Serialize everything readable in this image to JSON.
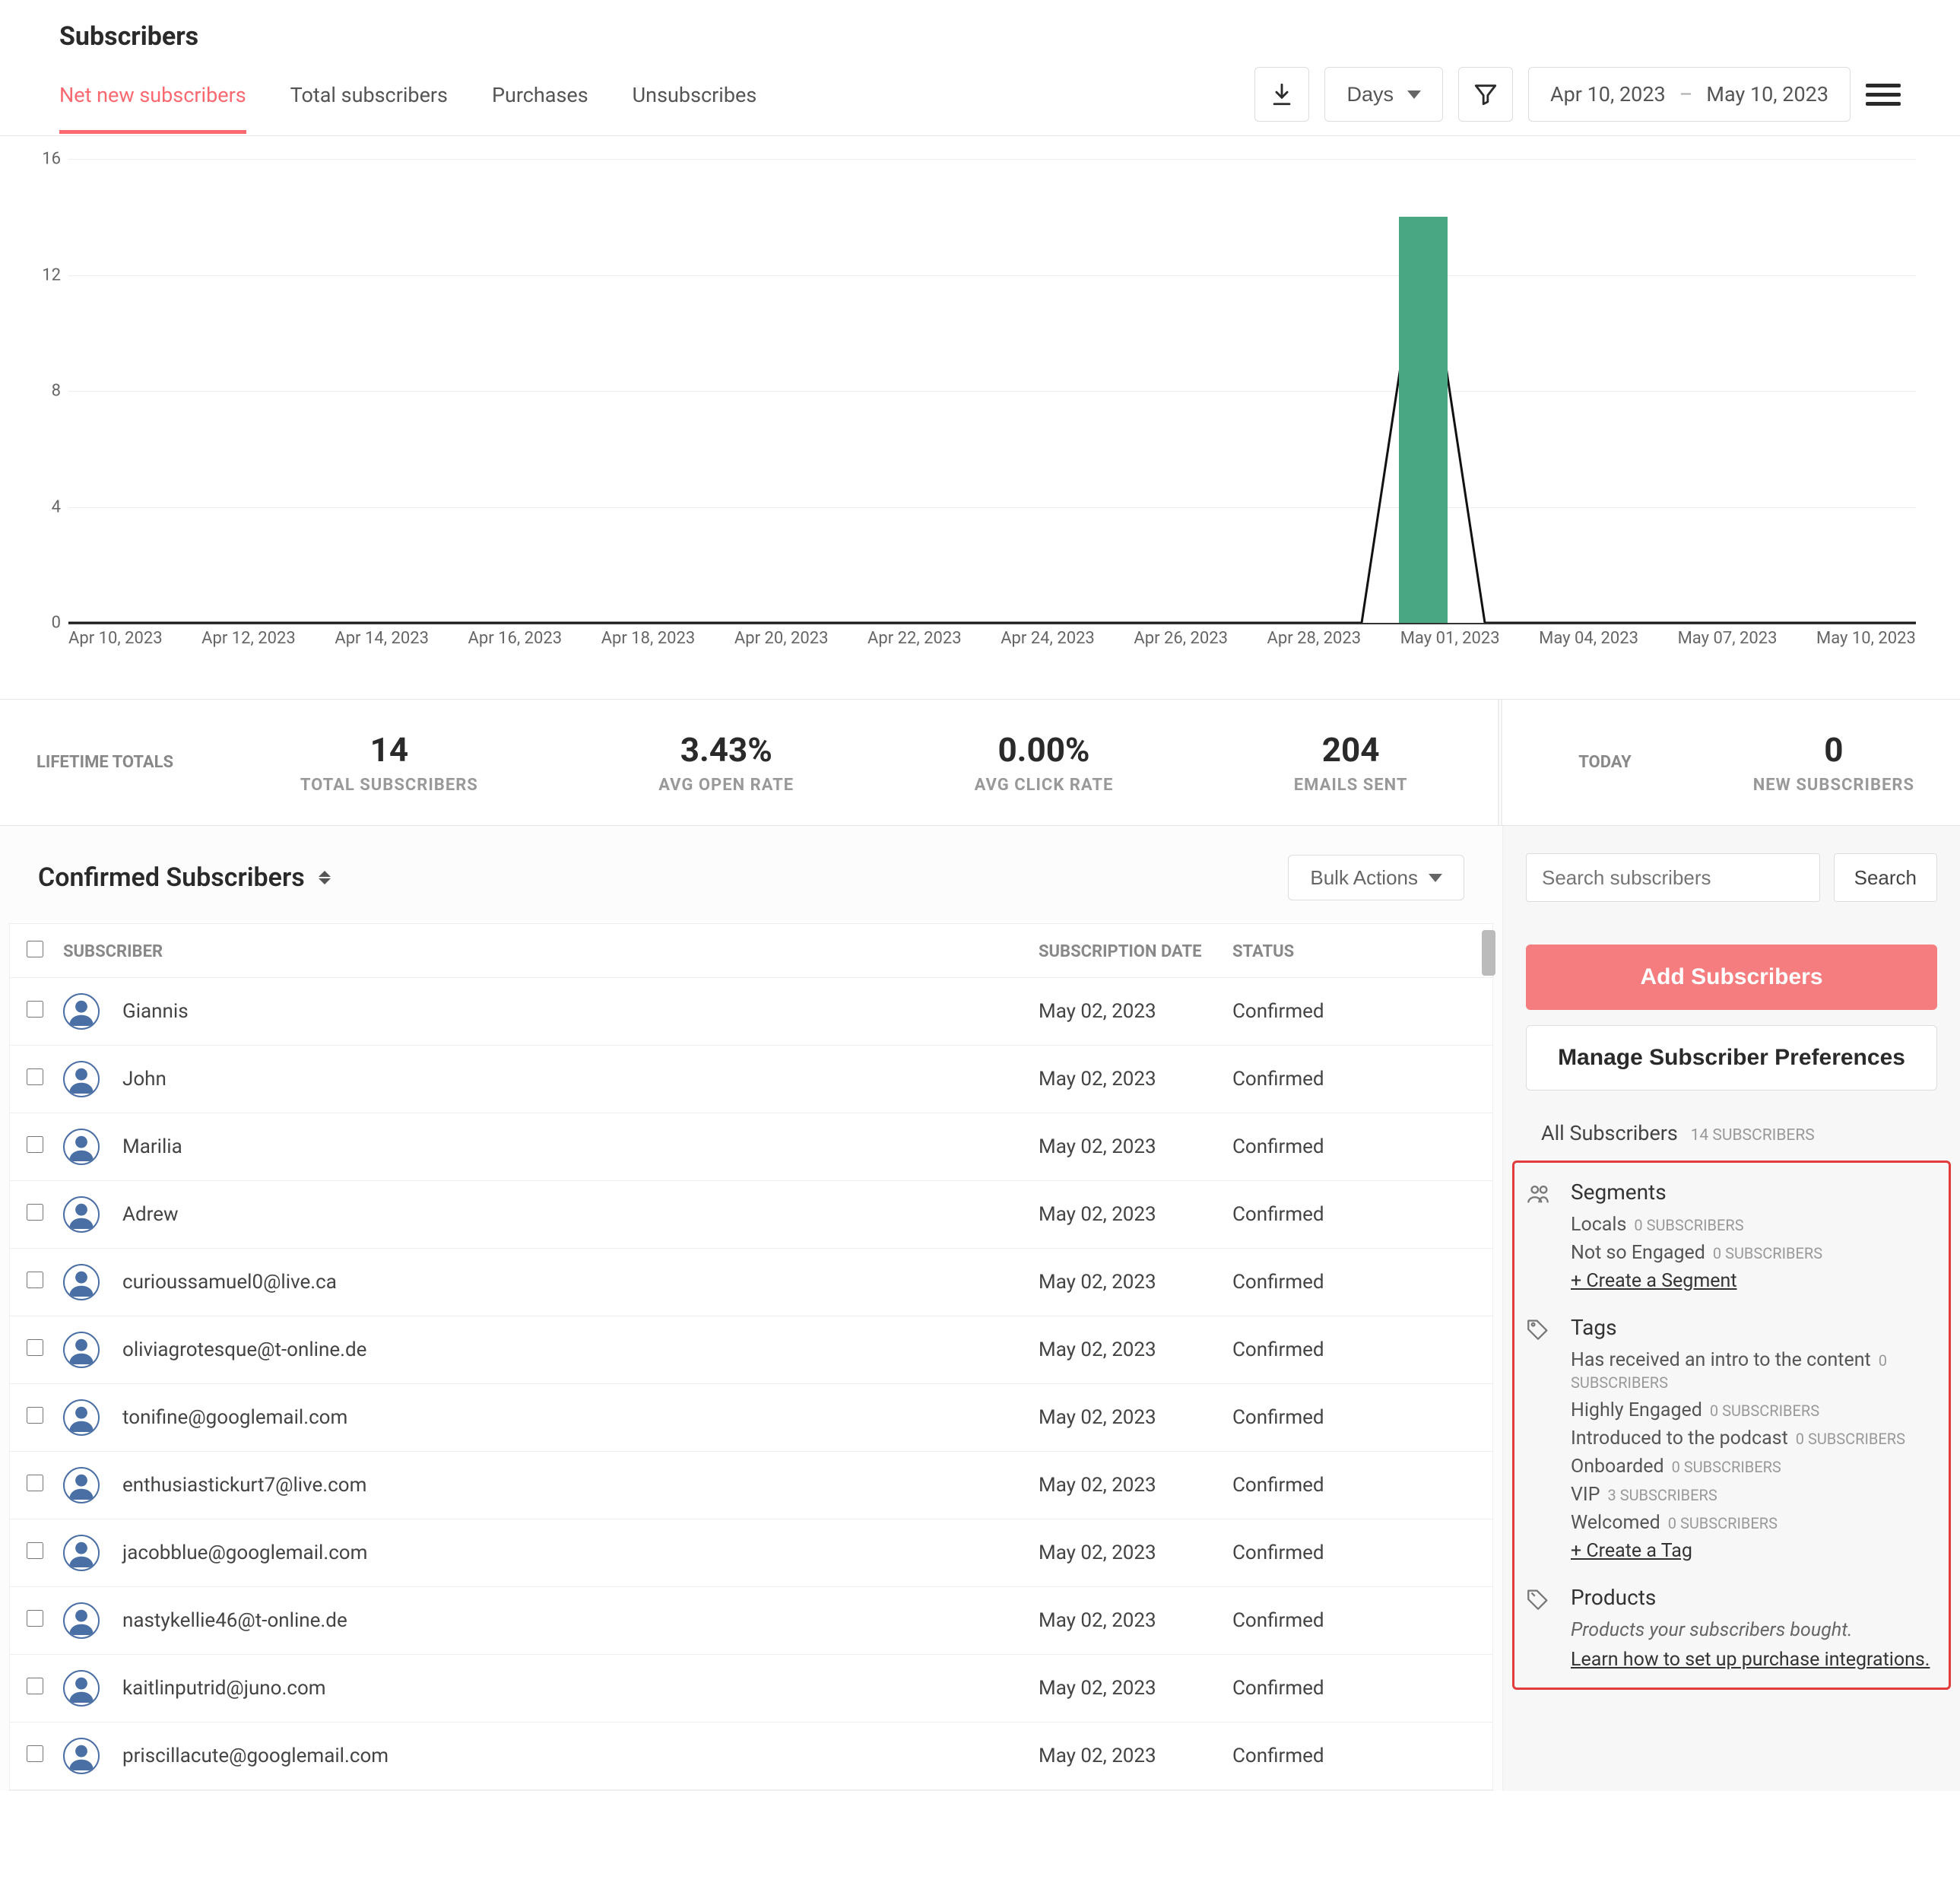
{
  "page": {
    "title": "Subscribers"
  },
  "tabs": {
    "items": [
      "Net new subscribers",
      "Total subscribers",
      "Purchases",
      "Unsubscribes"
    ],
    "active": 0
  },
  "controls": {
    "interval": "Days",
    "date_from": "Apr 10, 2023",
    "date_sep": "–",
    "date_to": "May 10, 2023"
  },
  "chart_data": {
    "type": "bar",
    "title": "",
    "xlabel": "",
    "ylabel": "",
    "ylim": [
      0,
      16
    ],
    "y_ticks": [
      0,
      4,
      8,
      12,
      16
    ],
    "x_labels": [
      "Apr 10, 2023",
      "Apr 12, 2023",
      "Apr 14, 2023",
      "Apr 16, 2023",
      "Apr 18, 2023",
      "Apr 20, 2023",
      "Apr 22, 2023",
      "Apr 24, 2023",
      "Apr 26, 2023",
      "Apr 28, 2023",
      "May 01, 2023",
      "May 04, 2023",
      "May 07, 2023",
      "May 10, 2023"
    ],
    "series": [
      {
        "name": "Net new",
        "type": "bar",
        "values": [
          0,
          0,
          0,
          0,
          0,
          0,
          0,
          0,
          0,
          0,
          0,
          0,
          0,
          0,
          0,
          0,
          0,
          0,
          0,
          0,
          0,
          0,
          14,
          0,
          0,
          0,
          0,
          0,
          0,
          0,
          0
        ]
      },
      {
        "name": "Line",
        "type": "line",
        "values": [
          0,
          0,
          0,
          0,
          0,
          0,
          0,
          0,
          0,
          0,
          0,
          0,
          0,
          0,
          0,
          0,
          0,
          0,
          0,
          0,
          0,
          0,
          14,
          0,
          0,
          0,
          0,
          0,
          0,
          0,
          0
        ]
      }
    ],
    "n_points": 31
  },
  "metrics": {
    "lifetime_label": "LIFETIME TOTALS",
    "today_label": "TODAY",
    "stats": [
      {
        "value": "14",
        "label": "TOTAL SUBSCRIBERS"
      },
      {
        "value": "3.43%",
        "label": "AVG OPEN RATE"
      },
      {
        "value": "0.00%",
        "label": "AVG CLICK RATE"
      },
      {
        "value": "204",
        "label": "EMAILS SENT"
      }
    ],
    "today": {
      "value": "0",
      "label": "NEW SUBSCRIBERS"
    }
  },
  "table": {
    "title": "Confirmed Subscribers",
    "bulk_label": "Bulk Actions",
    "columns": {
      "subscriber": "SUBSCRIBER",
      "date": "SUBSCRIPTION DATE",
      "status": "STATUS"
    },
    "rows": [
      {
        "name": "Giannis",
        "date": "May 02, 2023",
        "status": "Confirmed"
      },
      {
        "name": "John",
        "date": "May 02, 2023",
        "status": "Confirmed"
      },
      {
        "name": "Marilia",
        "date": "May 02, 2023",
        "status": "Confirmed"
      },
      {
        "name": "Adrew",
        "date": "May 02, 2023",
        "status": "Confirmed"
      },
      {
        "name": "curioussamuel0@live.ca",
        "date": "May 02, 2023",
        "status": "Confirmed"
      },
      {
        "name": "oliviagrotesque@t-online.de",
        "date": "May 02, 2023",
        "status": "Confirmed"
      },
      {
        "name": "tonifine@googlemail.com",
        "date": "May 02, 2023",
        "status": "Confirmed"
      },
      {
        "name": "enthusiastickurt7@live.com",
        "date": "May 02, 2023",
        "status": "Confirmed"
      },
      {
        "name": "jacobblue@googlemail.com",
        "date": "May 02, 2023",
        "status": "Confirmed"
      },
      {
        "name": "nastykellie46@t-online.de",
        "date": "May 02, 2023",
        "status": "Confirmed"
      },
      {
        "name": "kaitlinputrid@juno.com",
        "date": "May 02, 2023",
        "status": "Confirmed"
      },
      {
        "name": "priscillacute@googlemail.com",
        "date": "May 02, 2023",
        "status": "Confirmed"
      }
    ]
  },
  "right": {
    "search_placeholder": "Search subscribers",
    "search_button": "Search",
    "add_btn": "Add Subscribers",
    "manage_btn": "Manage Subscriber Preferences",
    "all": {
      "label": "All Subscribers",
      "count": "14 SUBSCRIBERS"
    },
    "segments": {
      "title": "Segments",
      "items": [
        {
          "label": "Locals",
          "count": "0 SUBSCRIBERS"
        },
        {
          "label": "Not so Engaged",
          "count": "0 SUBSCRIBERS"
        }
      ],
      "create": "+ Create a Segment"
    },
    "tags": {
      "title": "Tags",
      "items": [
        {
          "label": "Has received an intro to the content",
          "count": "0 SUBSCRIBERS"
        },
        {
          "label": "Highly Engaged",
          "count": "0 SUBSCRIBERS"
        },
        {
          "label": "Introduced to the podcast",
          "count": "0 SUBSCRIBERS"
        },
        {
          "label": "Onboarded",
          "count": "0 SUBSCRIBERS"
        },
        {
          "label": "VIP",
          "count": "3 SUBSCRIBERS"
        },
        {
          "label": "Welcomed",
          "count": "0 SUBSCRIBERS"
        }
      ],
      "create": "+ Create a Tag"
    },
    "products": {
      "title": "Products",
      "desc": "Products your subscribers bought.",
      "link": "Learn how to set up purchase integrations."
    }
  }
}
